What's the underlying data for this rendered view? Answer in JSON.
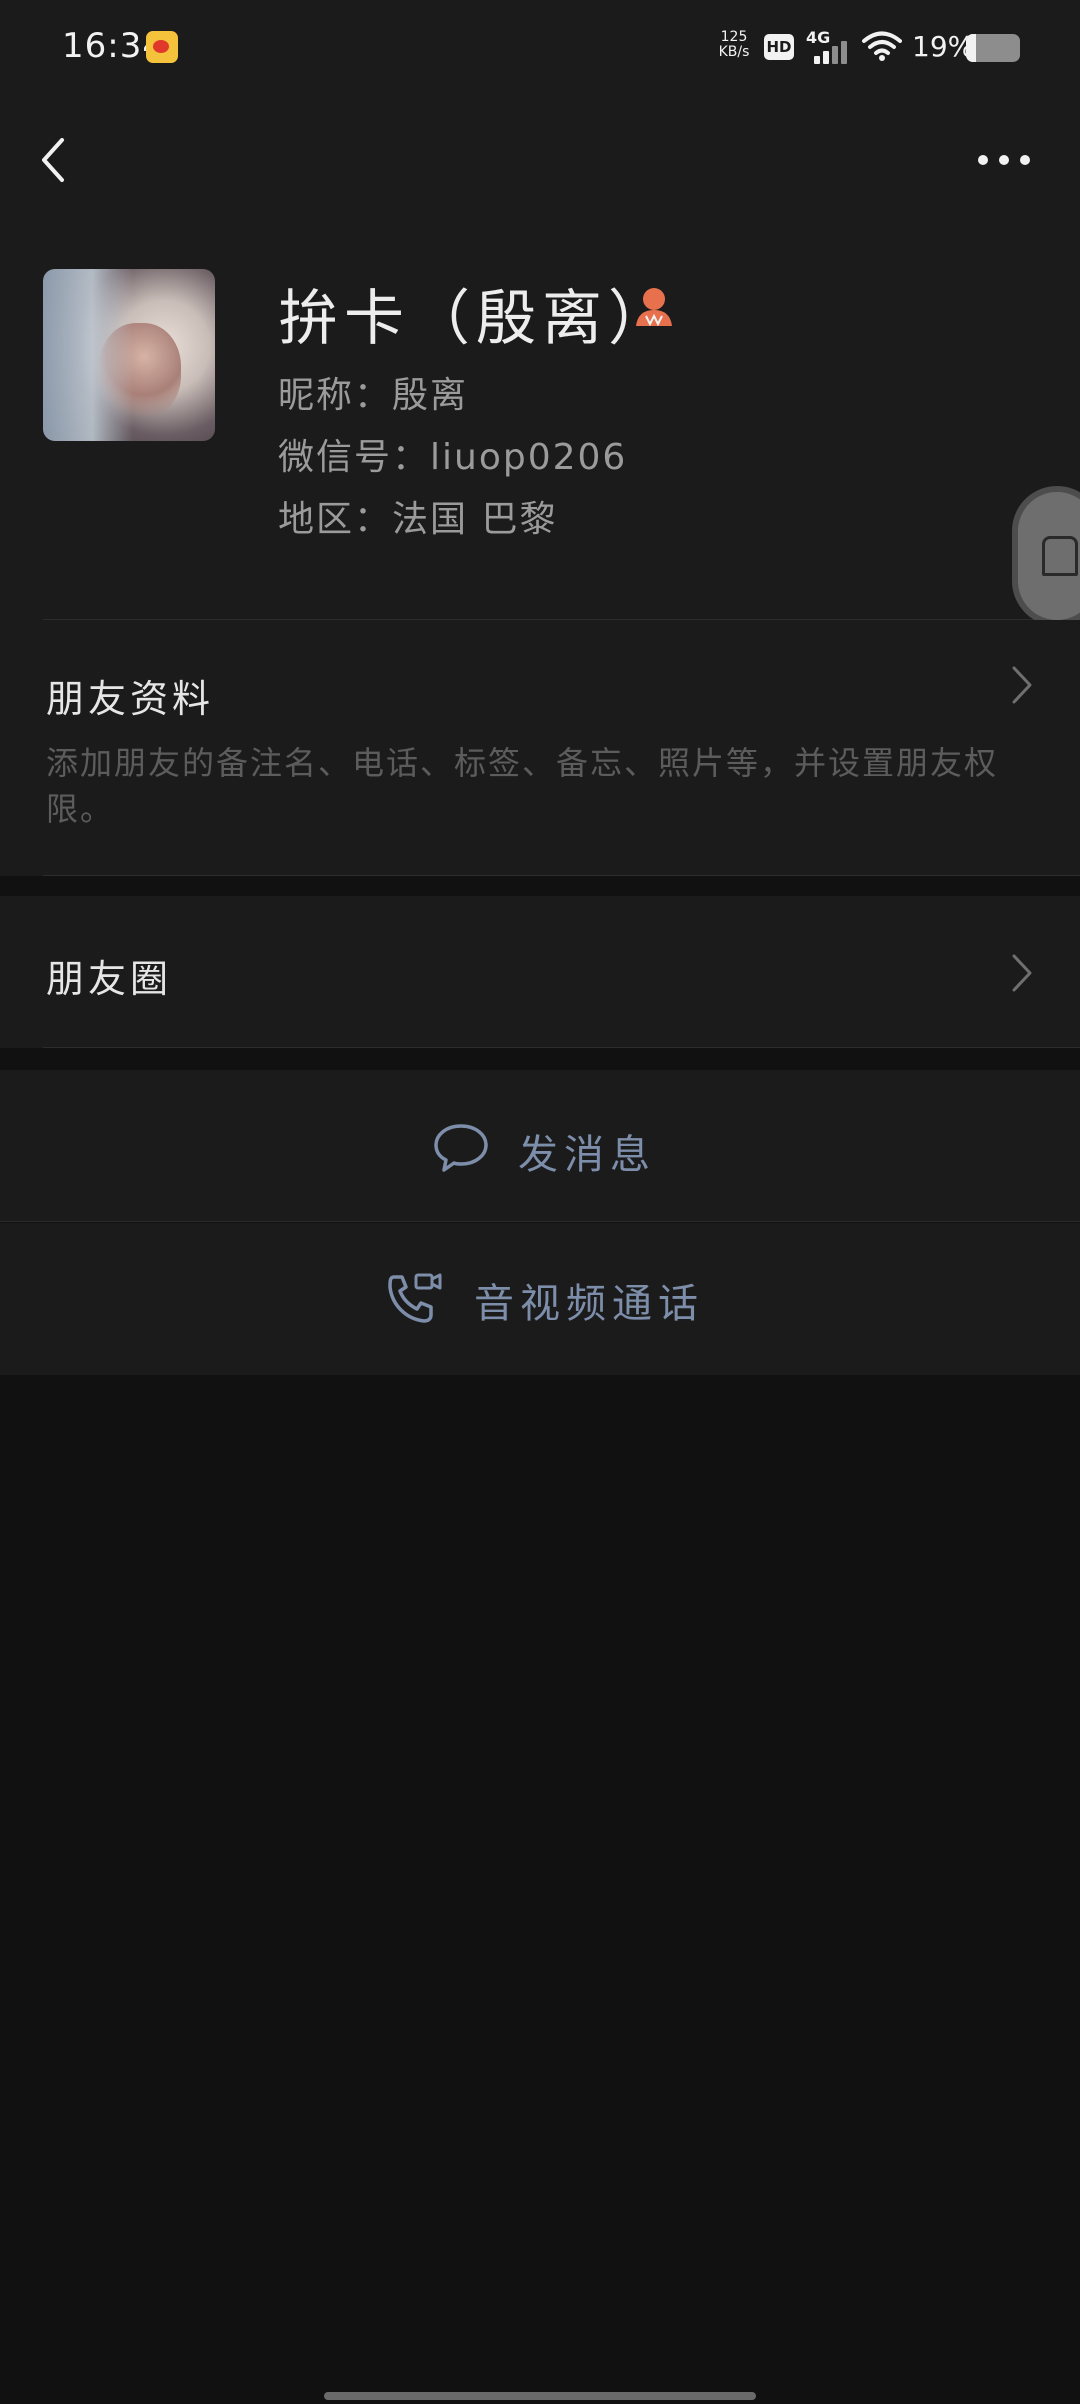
{
  "status_bar": {
    "time": "16:34",
    "net_speed_value": "125",
    "net_speed_unit": "KB/s",
    "hd": "HD",
    "network": "4G",
    "battery_percent": "19%",
    "battery_level": 0.19
  },
  "profile": {
    "name": "拚卡（殷离）",
    "nickname": "昵称：殷离",
    "wechat_id": "微信号：liuop0206",
    "region": "地区：法国  巴黎"
  },
  "friend_info": {
    "title": "朋友资料",
    "description": "添加朋友的备注名、电话、标签、备忘、照片等，并设置朋友权限。"
  },
  "moments": {
    "title": "朋友圈"
  },
  "actions": {
    "send_message": "发消息",
    "av_call": "音视频通话"
  },
  "colors": {
    "background": "#111111",
    "card": "#1b1b1b",
    "action_text": "#7d8eaa",
    "person_icon": "#e8714d"
  }
}
